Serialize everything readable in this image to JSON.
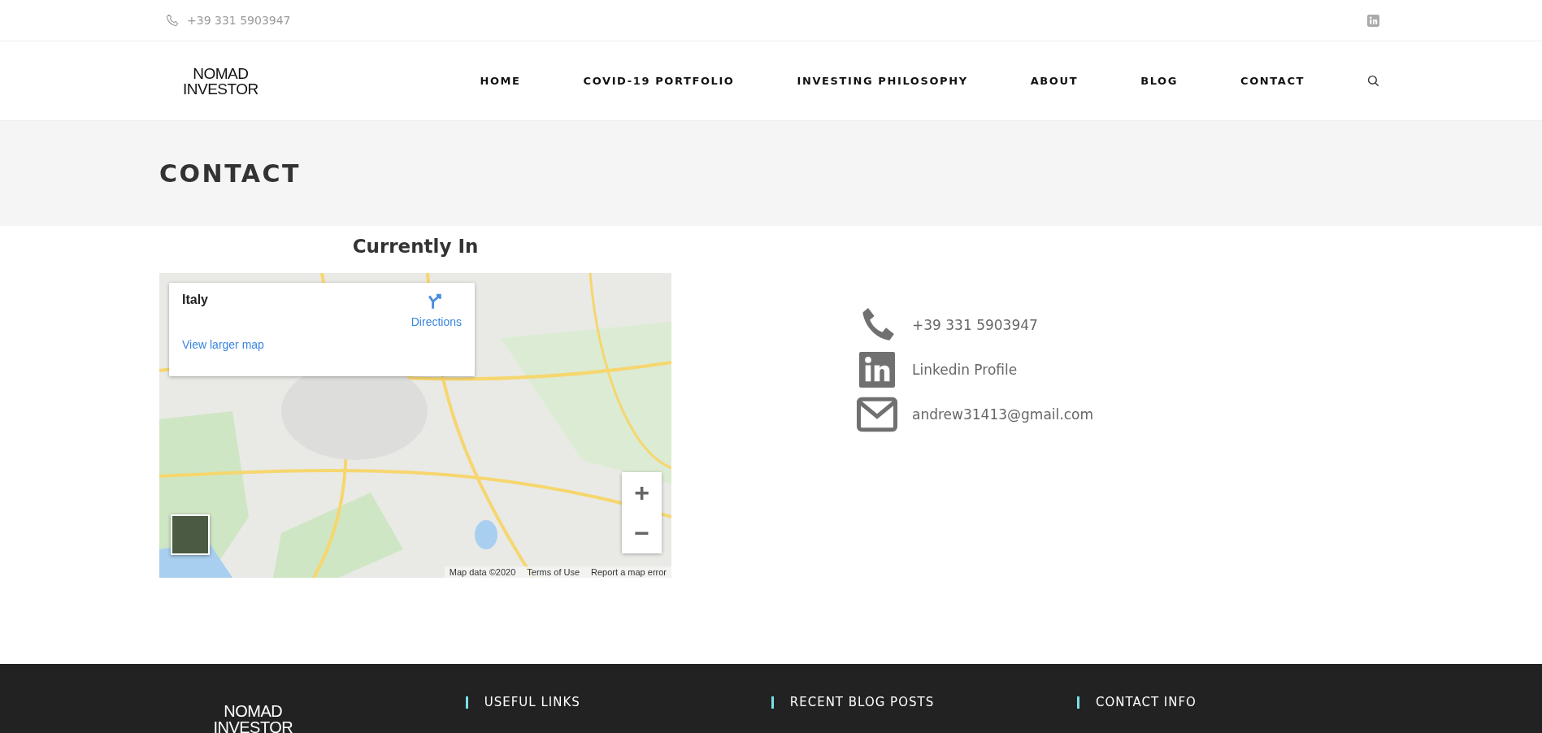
{
  "topbar": {
    "phone": "+39 331 5903947"
  },
  "header": {
    "logo_lines": [
      "NOMAD",
      "INVESTOR"
    ],
    "nav": [
      {
        "label": "HOME",
        "selected": false
      },
      {
        "label": "COVID-19 PORTFOLIO",
        "selected": false
      },
      {
        "label": "INVESTING PHILOSOPHY",
        "selected": false
      },
      {
        "label": "ABOUT",
        "selected": false
      },
      {
        "label": "BLOG",
        "selected": false
      },
      {
        "label": "CONTACT",
        "selected": false
      }
    ]
  },
  "page_title": "CONTACT",
  "map_section": {
    "heading": "Currently In",
    "info_card": {
      "place": "Italy",
      "directions": "Directions",
      "larger_map": "View larger map"
    },
    "zoom_in": "+",
    "zoom_out": "−",
    "attribution": [
      "Map data ©2020",
      "Terms of Use",
      "Report a map error"
    ]
  },
  "contacts": [
    {
      "kind": "phone",
      "text": "+39 331 5903947"
    },
    {
      "kind": "linkedin",
      "text": "Linkedin Profile"
    },
    {
      "kind": "email",
      "text": "andrew31413@gmail.com"
    }
  ],
  "footer": {
    "logo_lines": [
      "NOMAD",
      "INVESTOR"
    ],
    "headings": [
      "USEFUL LINKS",
      "RECENT BLOG POSTS",
      "CONTACT INFO"
    ]
  }
}
